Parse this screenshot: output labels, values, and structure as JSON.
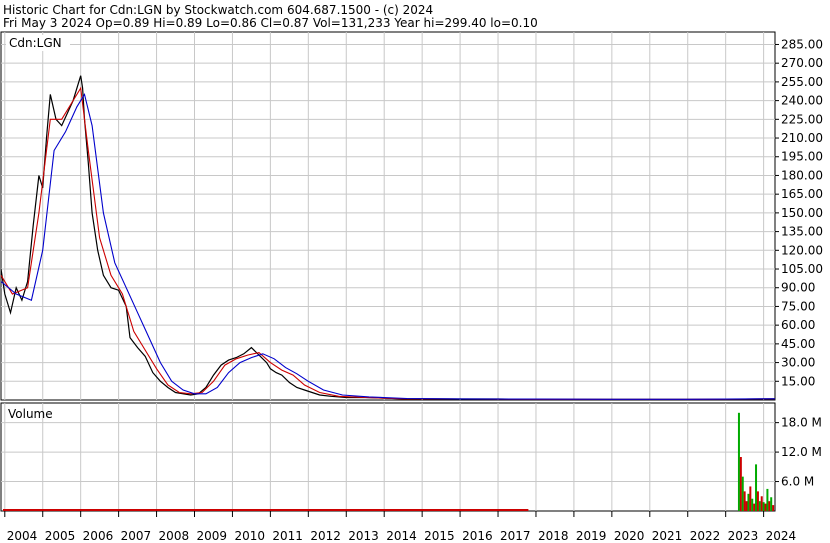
{
  "header": {
    "line1": "Historic Chart for Cdn:LGN by Stockwatch.com 604.687.1500 - (c) 2024",
    "line2": "Fri May  3 2024  Op=0.89  Hi=0.89  Lo=0.86  Cl=0.87  Vol=131,233  Year hi=299.40  lo=0.10"
  },
  "chart_data": [
    {
      "type": "line",
      "title": "Cdn:LGN",
      "ylim": [
        0,
        295
      ],
      "y_ticks": [
        15,
        30,
        45,
        60,
        75,
        90,
        105,
        120,
        135,
        150,
        165,
        180,
        195,
        210,
        225,
        240,
        255,
        270,
        285
      ],
      "y_tick_labels": [
        "15.00",
        "30.00",
        "45.00",
        "60.00",
        "75.00",
        "90.00",
        "105.00",
        "120.00",
        "135.00",
        "150.00",
        "165.00",
        "180.00",
        "195.00",
        "210.00",
        "225.00",
        "240.00",
        "255.00",
        "270.00",
        "285.00"
      ],
      "x_ticks": [
        2004,
        2005,
        2006,
        2007,
        2008,
        2009,
        2010,
        2011,
        2012,
        2013,
        2014,
        2015,
        2016,
        2017,
        2018,
        2019,
        2020,
        2021,
        2022,
        2023,
        2024
      ],
      "x_tick_labels": [
        "2004",
        "2005",
        "2006",
        "2007",
        "2008",
        "2009",
        "2010",
        "2011",
        "2012",
        "2013",
        "2014",
        "2015",
        "2016",
        "2017",
        "2018",
        "2019",
        "2020",
        "2021",
        "2022",
        "2023",
        "2024"
      ],
      "xlim": [
        2003.9,
        2024.3
      ],
      "grid": true,
      "series": [
        {
          "color": "#000000",
          "x": [
            2003.9,
            2004.0,
            2004.15,
            2004.3,
            2004.45,
            2004.6,
            2004.75,
            2004.9,
            2005.0,
            2005.1,
            2005.2,
            2005.35,
            2005.5,
            2005.65,
            2005.8,
            2005.95,
            2006.0,
            2006.05,
            2006.1,
            2006.2,
            2006.3,
            2006.45,
            2006.6,
            2006.8,
            2007.0,
            2007.2,
            2007.3,
            2007.5,
            2007.7,
            2007.9,
            2008.1,
            2008.3,
            2008.5,
            2008.7,
            2008.9,
            2009.1,
            2009.3,
            2009.5,
            2009.7,
            2009.9,
            2010.1,
            2010.3,
            2010.5,
            2010.7,
            2010.9,
            2011.0,
            2011.15,
            2011.3,
            2011.5,
            2011.7,
            2011.9,
            2012.1,
            2012.3,
            2012.6,
            2013.0,
            2013.5,
            2014.0,
            2014.5,
            2015.0,
            2016.0,
            2017.0,
            2018.0,
            2019.0,
            2020.0,
            2021.0,
            2022.0,
            2023.0,
            2023.5,
            2024.0,
            2024.3
          ],
          "y": [
            105,
            85,
            70,
            90,
            80,
            95,
            140,
            180,
            170,
            210,
            245,
            225,
            220,
            230,
            240,
            255,
            260,
            250,
            225,
            190,
            150,
            120,
            100,
            90,
            88,
            75,
            50,
            42,
            35,
            22,
            15,
            10,
            6,
            5,
            4,
            5,
            10,
            20,
            28,
            32,
            34,
            37,
            42,
            36,
            30,
            25,
            22,
            20,
            14,
            10,
            8,
            6,
            4,
            3,
            2,
            2,
            1.5,
            1,
            1,
            0.8,
            0.8,
            0.6,
            0.5,
            0.5,
            0.5,
            0.5,
            0.6,
            0.7,
            0.8,
            0.87
          ]
        },
        {
          "color": "#cc0000",
          "x": [
            2003.9,
            2004.2,
            2004.6,
            2004.9,
            2005.2,
            2005.5,
            2005.8,
            2006.0,
            2006.2,
            2006.5,
            2006.8,
            2007.1,
            2007.4,
            2007.7,
            2008.0,
            2008.3,
            2008.6,
            2008.9,
            2009.2,
            2009.5,
            2009.8,
            2010.1,
            2010.4,
            2010.7,
            2011.0,
            2011.3,
            2011.6,
            2011.9,
            2012.3,
            2012.8,
            2013.5,
            2014.5,
            2016.0,
            2018.0,
            2020.0,
            2022.0,
            2023.5,
            2024.3
          ],
          "y": [
            100,
            85,
            90,
            150,
            225,
            225,
            240,
            250,
            200,
            130,
            100,
            85,
            55,
            40,
            25,
            12,
            6,
            5,
            6,
            15,
            28,
            33,
            36,
            38,
            30,
            24,
            20,
            12,
            6,
            3,
            2,
            1,
            0.8,
            0.6,
            0.5,
            0.5,
            0.7,
            0.87
          ]
        },
        {
          "color": "#0000cc",
          "x": [
            2003.9,
            2004.3,
            2004.7,
            2005.0,
            2005.3,
            2005.6,
            2005.9,
            2006.1,
            2006.3,
            2006.6,
            2006.9,
            2007.2,
            2007.5,
            2007.8,
            2008.1,
            2008.4,
            2008.7,
            2009.0,
            2009.3,
            2009.6,
            2009.9,
            2010.2,
            2010.5,
            2010.8,
            2011.1,
            2011.4,
            2011.7,
            2012.0,
            2012.4,
            2012.9,
            2013.6,
            2014.6,
            2016.0,
            2018.0,
            2020.0,
            2022.0,
            2023.5,
            2024.3
          ],
          "y": [
            95,
            85,
            80,
            120,
            200,
            215,
            235,
            245,
            220,
            150,
            110,
            90,
            70,
            50,
            30,
            15,
            8,
            5,
            5,
            10,
            22,
            30,
            34,
            37,
            33,
            26,
            21,
            15,
            8,
            4,
            2.5,
            1.2,
            0.9,
            0.7,
            0.6,
            0.6,
            0.9,
            1.0
          ]
        }
      ]
    },
    {
      "type": "bar",
      "title": "Volume",
      "ylim": [
        0,
        22000000
      ],
      "y_ticks": [
        6000000,
        12000000,
        18000000
      ],
      "y_tick_labels": [
        "6.0 M",
        "12.0 M",
        "18.0 M"
      ],
      "x": [
        2023.35,
        2023.4,
        2023.45,
        2023.5,
        2023.55,
        2023.6,
        2023.65,
        2023.7,
        2023.75,
        2023.8,
        2023.85,
        2023.9,
        2023.95,
        2024.0,
        2024.05,
        2024.1,
        2024.15,
        2024.2,
        2024.25
      ],
      "values": [
        20000000,
        11000000,
        7000000,
        4000000,
        2000000,
        3500000,
        5000000,
        2500000,
        1500000,
        9500000,
        4000000,
        2000000,
        3000000,
        1800000,
        1500000,
        4500000,
        2000000,
        2800000,
        1200000
      ],
      "colors": [
        "#00aa00",
        "#cc0000",
        "#00aa00",
        "#cc0000",
        "#cc0000",
        "#00aa00",
        "#cc0000",
        "#00aa00",
        "#cc0000",
        "#00aa00",
        "#cc0000",
        "#00aa00",
        "#cc0000",
        "#00aa00",
        "#cc0000",
        "#00aa00",
        "#cc0000",
        "#00aa00",
        "#cc0000"
      ],
      "baseline_color": "#cc0000"
    }
  ]
}
